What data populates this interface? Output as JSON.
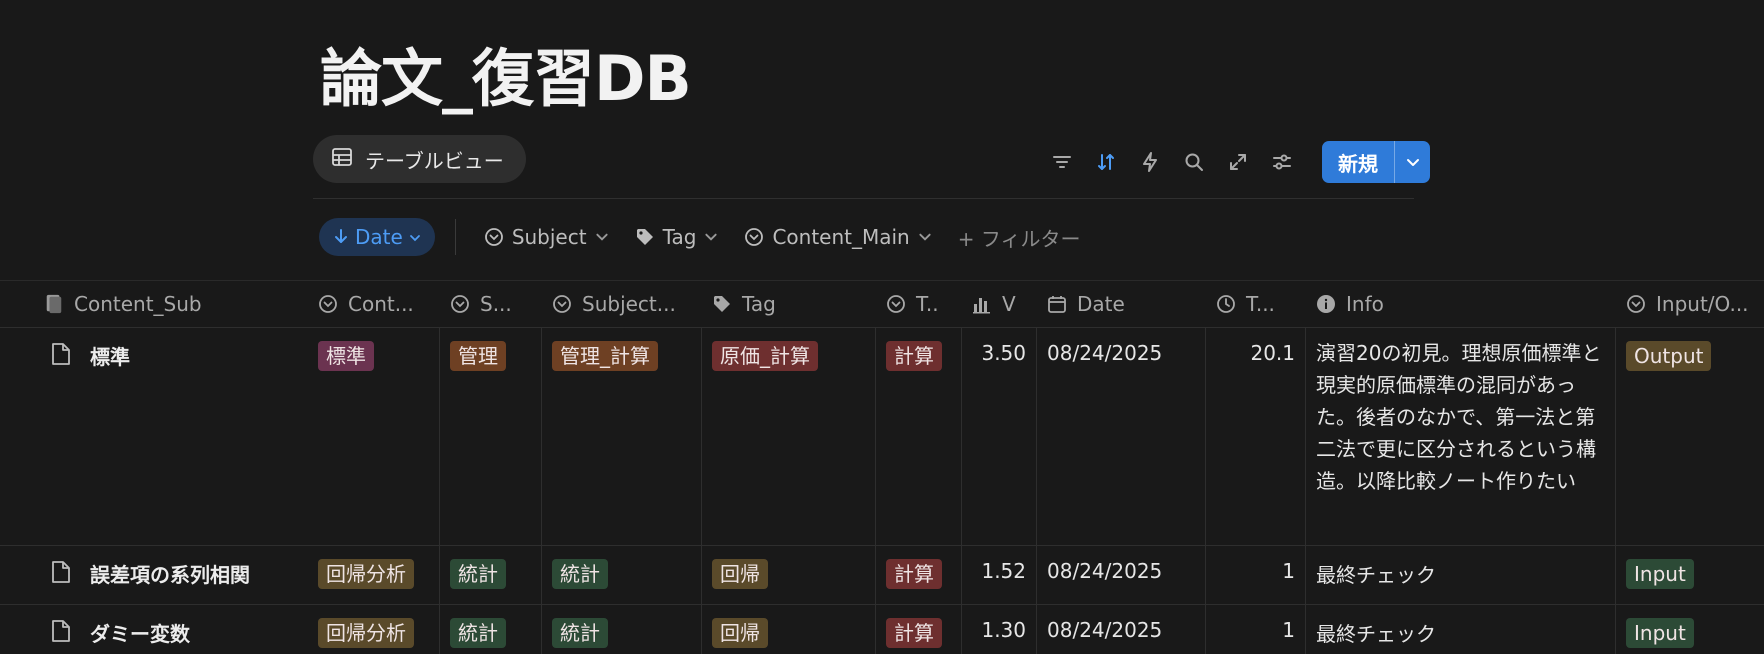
{
  "page_title": "論文_復習DB",
  "view_tab": {
    "label": "テーブルビュー",
    "icon": "table-icon"
  },
  "toolbar": {
    "icons": [
      "filter-lines-icon",
      "sort-icon",
      "lightning-icon",
      "search-icon",
      "expand-icon",
      "settings-sliders-icon"
    ],
    "new_label": "新規",
    "colors": {
      "accent": "#2f7bd9",
      "sort_active": "#4d9cf5"
    }
  },
  "filters": {
    "date_chip": "Date",
    "subject_chip": "Subject",
    "tag_chip": "Tag",
    "content_main_chip": "Content_Main",
    "add_filter": "+ フィルター"
  },
  "table": {
    "headers": {
      "content_sub": "Content_Sub",
      "cont": "Cont...",
      "s": "S...",
      "subject": "Subject...",
      "tag": "Tag",
      "t1": "T..",
      "v": "V",
      "date": "Date",
      "t2": "T...",
      "info": "Info",
      "input_output": "Input/O..."
    },
    "rows": [
      {
        "name": "標準",
        "content": "標準",
        "content_color": "#6b3350",
        "s": "管理",
        "s_color": "#6e4023",
        "subject": "管理_計算",
        "subject_color": "#6e4023",
        "tag": "原価_計算",
        "tag_color": "#6e2f2f",
        "t1": "計算",
        "t1_color": "#6e2f2f",
        "v": "3.50",
        "date": "08/24/2025",
        "t2": "20.1",
        "info": "演習20の初見。理想原価標準と現実的原価標準の混同があった。後者のなかで、第一法と第二法で更に区分されるという構造。以降比較ノート作りたい",
        "io": "Output",
        "io_color": "#5a4a2a"
      },
      {
        "name": "誤差項の系列相関",
        "content": "回帰分析",
        "content_color": "#5a4a2a",
        "s": "統計",
        "s_color": "#2c4a36",
        "subject": "統計",
        "subject_color": "#2c4a36",
        "tag": "回帰",
        "tag_color": "#5a4a2a",
        "t1": "計算",
        "t1_color": "#6e2f2f",
        "v": "1.52",
        "date": "08/24/2025",
        "t2": "1",
        "info": "最終チェック",
        "io": "Input",
        "io_color": "#2c4a36"
      },
      {
        "name": "ダミー変数",
        "content": "回帰分析",
        "content_color": "#5a4a2a",
        "s": "統計",
        "s_color": "#2c4a36",
        "subject": "統計",
        "subject_color": "#2c4a36",
        "tag": "回帰",
        "tag_color": "#5a4a2a",
        "t1": "計算",
        "t1_color": "#6e2f2f",
        "v": "1.30",
        "date": "08/24/2025",
        "t2": "1",
        "info": "最終チェック",
        "io": "Input",
        "io_color": "#2c4a36"
      }
    ]
  }
}
